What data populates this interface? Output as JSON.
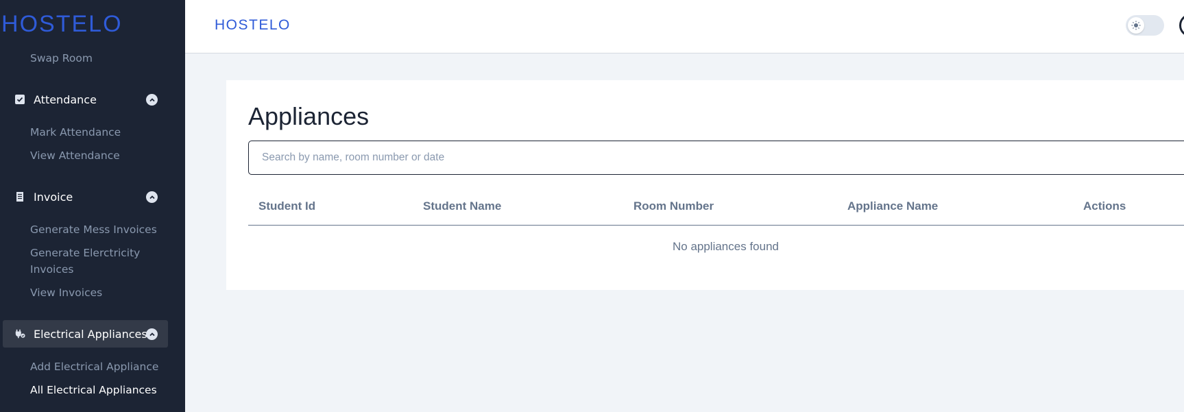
{
  "sidebar": {
    "logo": {
      "prefix": "H",
      "o": "O",
      "suffix": "STEL",
      "end": "O"
    },
    "swap_room": "Swap Room",
    "attendance": {
      "label": "Attendance",
      "items": [
        "Mark Attendance",
        "View Attendance"
      ]
    },
    "invoice": {
      "label": "Invoice",
      "items": [
        "Generate Mess Invoices",
        "Generate Elerctricity",
        "Invoices",
        "View Invoices"
      ]
    },
    "electrical": {
      "label": "Electrical Appliances",
      "items": [
        "Add Electrical Appliance",
        "All Electrical Appliances"
      ]
    }
  },
  "header": {
    "brand": "HOSTELO",
    "icons": {
      "theme_toggle": "sun-icon"
    }
  },
  "main": {
    "title": "Appliances",
    "search_placeholder": "Search by name, room number or date",
    "columns": [
      "Student Id",
      "Student Name",
      "Room Number",
      "Appliance Name",
      "Actions"
    ],
    "empty_message": "No appliances found"
  },
  "colors": {
    "sidebar_bg": "#1c2434",
    "brand_blue": "#2f5bd8",
    "muted_text": "#8a99af",
    "page_bg": "#f1f4f8"
  }
}
